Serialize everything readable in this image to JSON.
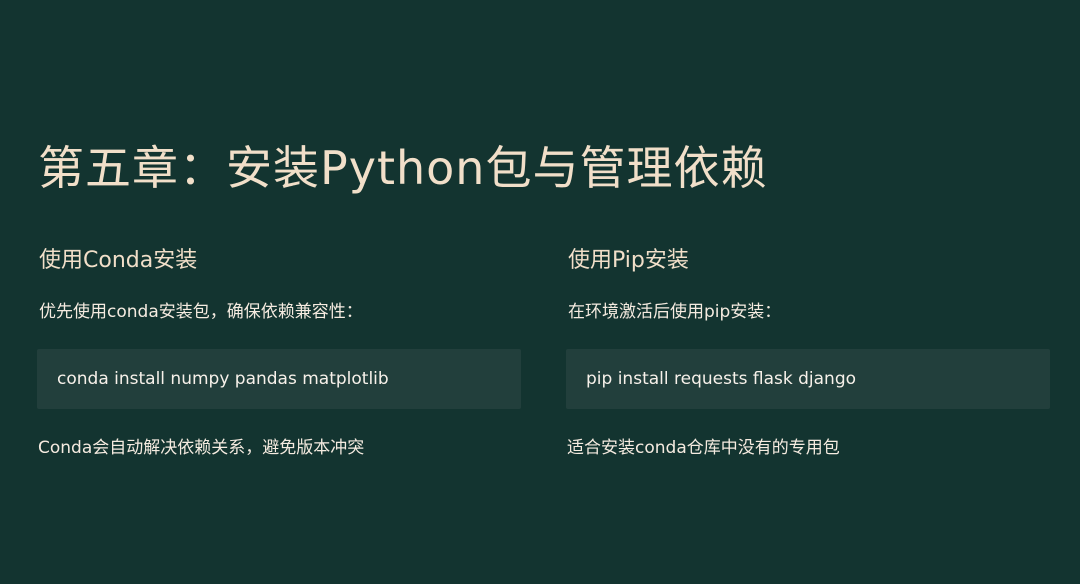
{
  "slide": {
    "title": "第五章：安装Python包与管理依赖",
    "columns": [
      {
        "heading": "使用Conda安装",
        "description": "优先使用conda安装包，确保依赖兼容性：",
        "code": "conda install numpy pandas matplotlib",
        "note": "Conda会自动解决依赖关系，避免版本冲突"
      },
      {
        "heading": "使用Pip安装",
        "description": "在环境激活后使用pip安装：",
        "code": "pip install requests flask django",
        "note": "适合安装conda仓库中没有的专用包"
      }
    ]
  },
  "colors": {
    "background": "#133430",
    "code_block_background": "#223f3c",
    "text": "#f1dfc9"
  }
}
